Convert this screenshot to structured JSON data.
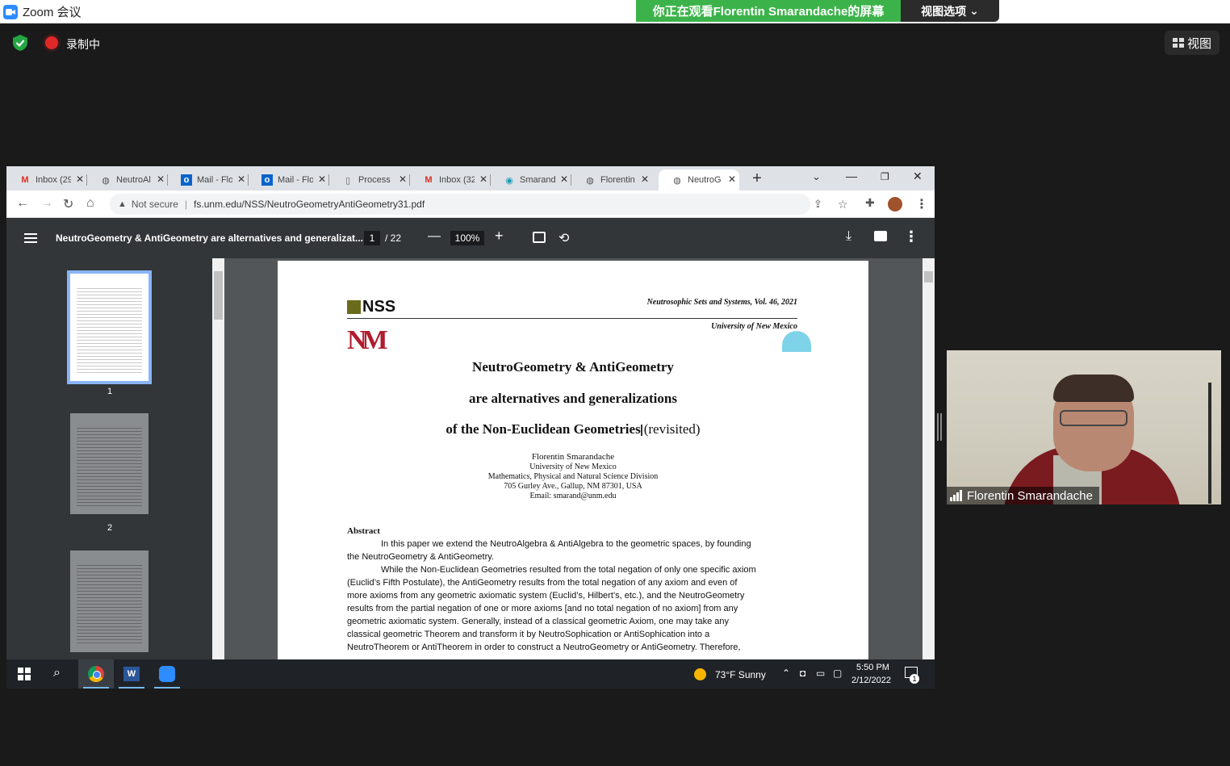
{
  "zoom": {
    "title": "Zoom 会议",
    "share_banner": "你正在观看Florentin Smarandache的屏幕",
    "view_options": "视图选项",
    "recording_label": "录制中",
    "view_button": "视图",
    "participant_name": "Florentin Smarandache"
  },
  "browser": {
    "tabs": [
      {
        "label": "Inbox (29",
        "icon": "gmail-icon"
      },
      {
        "label": "NeutroAl",
        "icon": "globe-icon"
      },
      {
        "label": "Mail - Flo",
        "icon": "outlook-icon"
      },
      {
        "label": "Mail - Flo",
        "icon": "outlook-icon"
      },
      {
        "label": "Process",
        "icon": "document-icon"
      },
      {
        "label": "Inbox (32",
        "icon": "gmail-icon"
      },
      {
        "label": "Smarand",
        "icon": "site-icon"
      },
      {
        "label": "Florentin",
        "icon": "globe-icon"
      },
      {
        "label": "NeutroG",
        "icon": "globe-icon"
      }
    ],
    "not_secure": "Not secure",
    "url": "fs.unm.edu/NSS/NeutroGeometryAntiGeometry31.pdf"
  },
  "pdf": {
    "doc_title": "NeutroGeometry & AntiGeometry are alternatives and generalizat...",
    "page_current": "1",
    "page_total": "/ 22",
    "zoom": "100%",
    "thumbnails": [
      "1",
      "2"
    ]
  },
  "paper": {
    "nss_logo": "NSS",
    "journal": "Neutrosophic Sets and Systems, Vol. 46, 2021",
    "university": "University of New Mexico",
    "unm_logo": "NM",
    "title_1": "NeutroGeometry & AntiGeometry",
    "title_2": "are alternatives and generalizations",
    "title_3a": "of the Non-Euclidean Geometries",
    "title_3b": "(revisited)",
    "author": "Florentin Smarandache",
    "affil_1": "University of New Mexico",
    "affil_2": "Mathematics, Physical and Natural Science Division",
    "affil_3": "705 Gurley Ave., Gallup, NM 87301, USA",
    "email": "Email: smarand@unm.edu",
    "abstract_head": "Abstract",
    "abstract_lines": [
      "In this paper we extend the NeutroAlgebra & AntiAlgebra to the geometric spaces, by founding",
      "the NeutroGeometry & AntiGeometry.",
      "While the Non-Euclidean Geometries resulted from the total negation of only one specific axiom",
      "(Euclid’s Fifth Postulate), the AntiGeometry results from the total negation of any axiom and even of",
      "more axioms from any geometric axiomatic system (Euclid’s, Hilbert’s, etc.), and the NeutroGeometry",
      "results from the partial negation of one or more axioms [and no total negation of no axiom] from any",
      "geometric axiomatic system. Generally, instead of a classical geometric Axiom, one may take any",
      "classical geometric Theorem and transform it by NeutroSophication or AntiSophication into a",
      "NeutroTheorem or AntiTheorem in order to construct a NeutroGeometry or AntiGeometry. Therefore,"
    ]
  },
  "taskbar": {
    "word_letter": "W",
    "weather": "73°F  Sunny",
    "time": "5:50 PM",
    "date": "2/12/2022",
    "notifications": "1"
  }
}
